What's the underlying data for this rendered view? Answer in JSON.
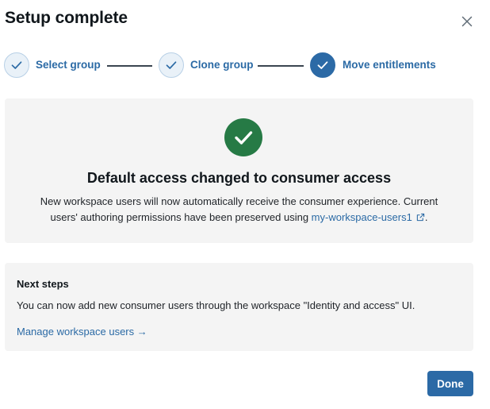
{
  "dialog": {
    "title": "Setup complete",
    "close_icon": "close-icon"
  },
  "stepper": {
    "steps": [
      {
        "label": "Select group",
        "state": "complete",
        "icon": "check-icon"
      },
      {
        "label": "Clone group",
        "state": "complete",
        "icon": "check-icon"
      },
      {
        "label": "Move entitlements",
        "state": "active",
        "icon": "check-icon"
      }
    ]
  },
  "success": {
    "icon": "check-circle-icon",
    "heading": "Default access changed to consumer access",
    "line1": "New workspace users will now automatically receive the consumer experience. Current",
    "line2_prefix": "users' authoring permissions have been preserved using ",
    "link_text": "my-workspace-users1",
    "link_icon": "external-link-icon",
    "line2_suffix": "."
  },
  "next_steps": {
    "heading": "Next steps",
    "body": "You can now add new consumer users through the workspace \"Identity and access\" UI.",
    "link_text": "Manage workspace users →"
  },
  "footer": {
    "done_label": "Done"
  },
  "colors": {
    "accent": "#2c6aa6",
    "link": "#2b6aa5",
    "success": "#267a45",
    "panel_bg": "#f4f4f4",
    "step_done_bg": "#e9f1f8"
  }
}
